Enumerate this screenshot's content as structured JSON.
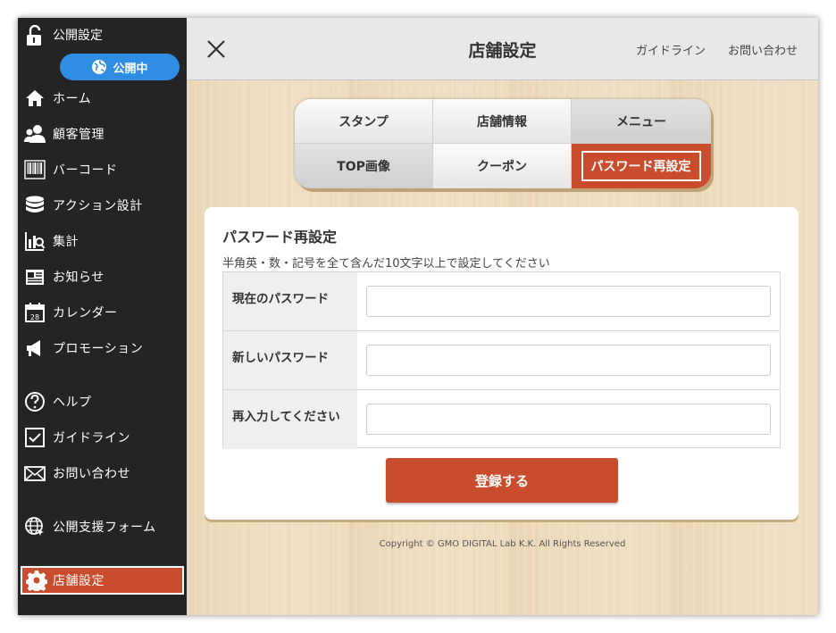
{
  "sidebar": {
    "status_label": "公開設定",
    "status_pill": "公開中",
    "items": [
      {
        "label": "ホーム",
        "icon": "home-icon"
      },
      {
        "label": "顧客管理",
        "icon": "customer-icon"
      },
      {
        "label": "バーコード",
        "icon": "barcode-icon"
      },
      {
        "label": "アクション設計",
        "icon": "database-icon"
      },
      {
        "label": "集計",
        "icon": "chart-icon"
      },
      {
        "label": "お知らせ",
        "icon": "news-icon"
      },
      {
        "label": "カレンダー",
        "icon": "calendar-icon"
      },
      {
        "label": "プロモーション",
        "icon": "megaphone-icon"
      },
      {
        "label": "ヘルプ",
        "icon": "help-icon"
      },
      {
        "label": "ガイドライン",
        "icon": "checkbox-icon"
      },
      {
        "label": "お問い合わせ",
        "icon": "mail-icon"
      },
      {
        "label": "公開支援フォーム",
        "icon": "globe-icon"
      },
      {
        "label": "店舗設定",
        "icon": "gear-icon"
      }
    ]
  },
  "header": {
    "title": "店舗設定",
    "guide_link": "ガイドライン",
    "contact_link": "お問い合わせ"
  },
  "tabs": [
    {
      "label": "スタンプ"
    },
    {
      "label": "店舗情報"
    },
    {
      "label": "メニュー"
    },
    {
      "label": "TOP画像"
    },
    {
      "label": "クーポン"
    },
    {
      "label": "パスワード再設定"
    }
  ],
  "form": {
    "title": "パスワード再設定",
    "hint": "半角英・数・記号を全て含んだ10文字以上で設定してください",
    "fields": [
      {
        "label": "現在のパスワード",
        "value": "",
        "placeholder": ""
      },
      {
        "label": "新しいパスワード",
        "value": "",
        "placeholder": ""
      },
      {
        "label": "再入力してください",
        "value": "",
        "placeholder": ""
      }
    ],
    "submit_label": "登録する"
  },
  "footer": {
    "copyright": "Copyright © GMO DIGITAL Lab K.K. All Rights Reserved"
  },
  "colors": {
    "sidebar_bg": "#242424",
    "accent": "#c94c2c",
    "status_pill": "#2f8de4",
    "header_bg": "#e8e8e8",
    "wood": "#eedcbd"
  }
}
